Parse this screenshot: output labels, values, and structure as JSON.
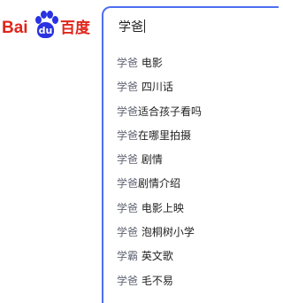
{
  "logo": {
    "left_text": "Bai",
    "paw_text": "du",
    "right_text": "百度"
  },
  "search": {
    "query": "学爸"
  },
  "suggestions": [
    {
      "prefix": "学爸",
      "rest": " 电影"
    },
    {
      "prefix": "学爸",
      "rest": " 四川话"
    },
    {
      "prefix": "学爸",
      "rest": "适合孩子看吗"
    },
    {
      "prefix": "学爸",
      "rest": "在哪里拍摄"
    },
    {
      "prefix": "学爸",
      "rest": " 剧情"
    },
    {
      "prefix": "学爸",
      "rest": "剧情介绍"
    },
    {
      "prefix": "学爸",
      "rest": " 电影上映"
    },
    {
      "prefix": "学爸",
      "rest": " 泡桐树小学"
    },
    {
      "prefix": "学霸",
      "rest": " 英文歌"
    },
    {
      "prefix": "学爸",
      "rest": " 毛不易"
    }
  ],
  "colors": {
    "brand_red": "#e1251b",
    "brand_blue": "#2932e1",
    "focus_border": "#4e6ef2"
  }
}
